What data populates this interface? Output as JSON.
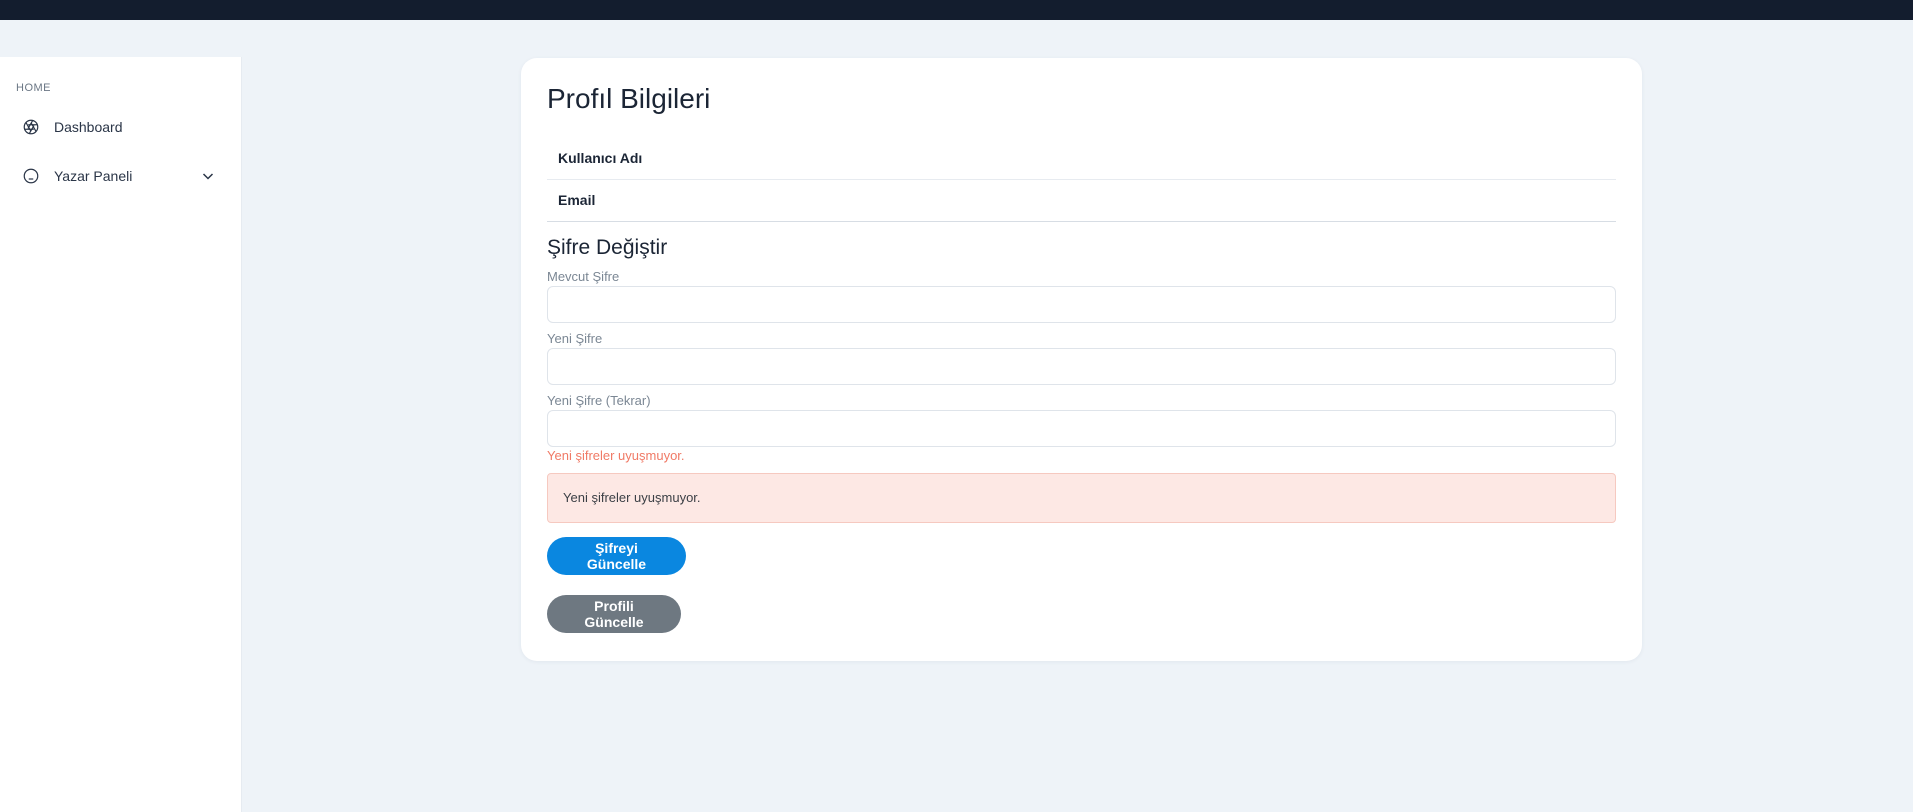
{
  "sidebar": {
    "section_label": "HOME",
    "items": [
      {
        "label": "Dashboard",
        "icon": "aperture-icon"
      },
      {
        "label": "Yazar Paneli",
        "icon": "smile-face-icon",
        "expandable": true
      }
    ]
  },
  "profile": {
    "title": "Profıl Bilgileri",
    "username_label": "Kullanıcı Adı",
    "email_label": "Email"
  },
  "password": {
    "title": "Şifre Değiştir",
    "current_label": "Mevcut Şifre",
    "current_value": "",
    "new_label": "Yeni Şifre",
    "new_value": "",
    "repeat_label": "Yeni Şifre (Tekrar)",
    "repeat_value": "",
    "mismatch_text": "Yeni şifreler uyuşmuyor.",
    "alert_text": "Yeni şifreler uyuşmuyor.",
    "update_password_button": "Şifreyi Güncelle",
    "update_profile_button": "Profili Güncelle"
  },
  "colors": {
    "topbar": "#131d2e",
    "primary_button": "#0a87e0",
    "secondary_button": "#6e7881",
    "error_text": "#f07a66",
    "alert_bg": "#fde8e4"
  }
}
